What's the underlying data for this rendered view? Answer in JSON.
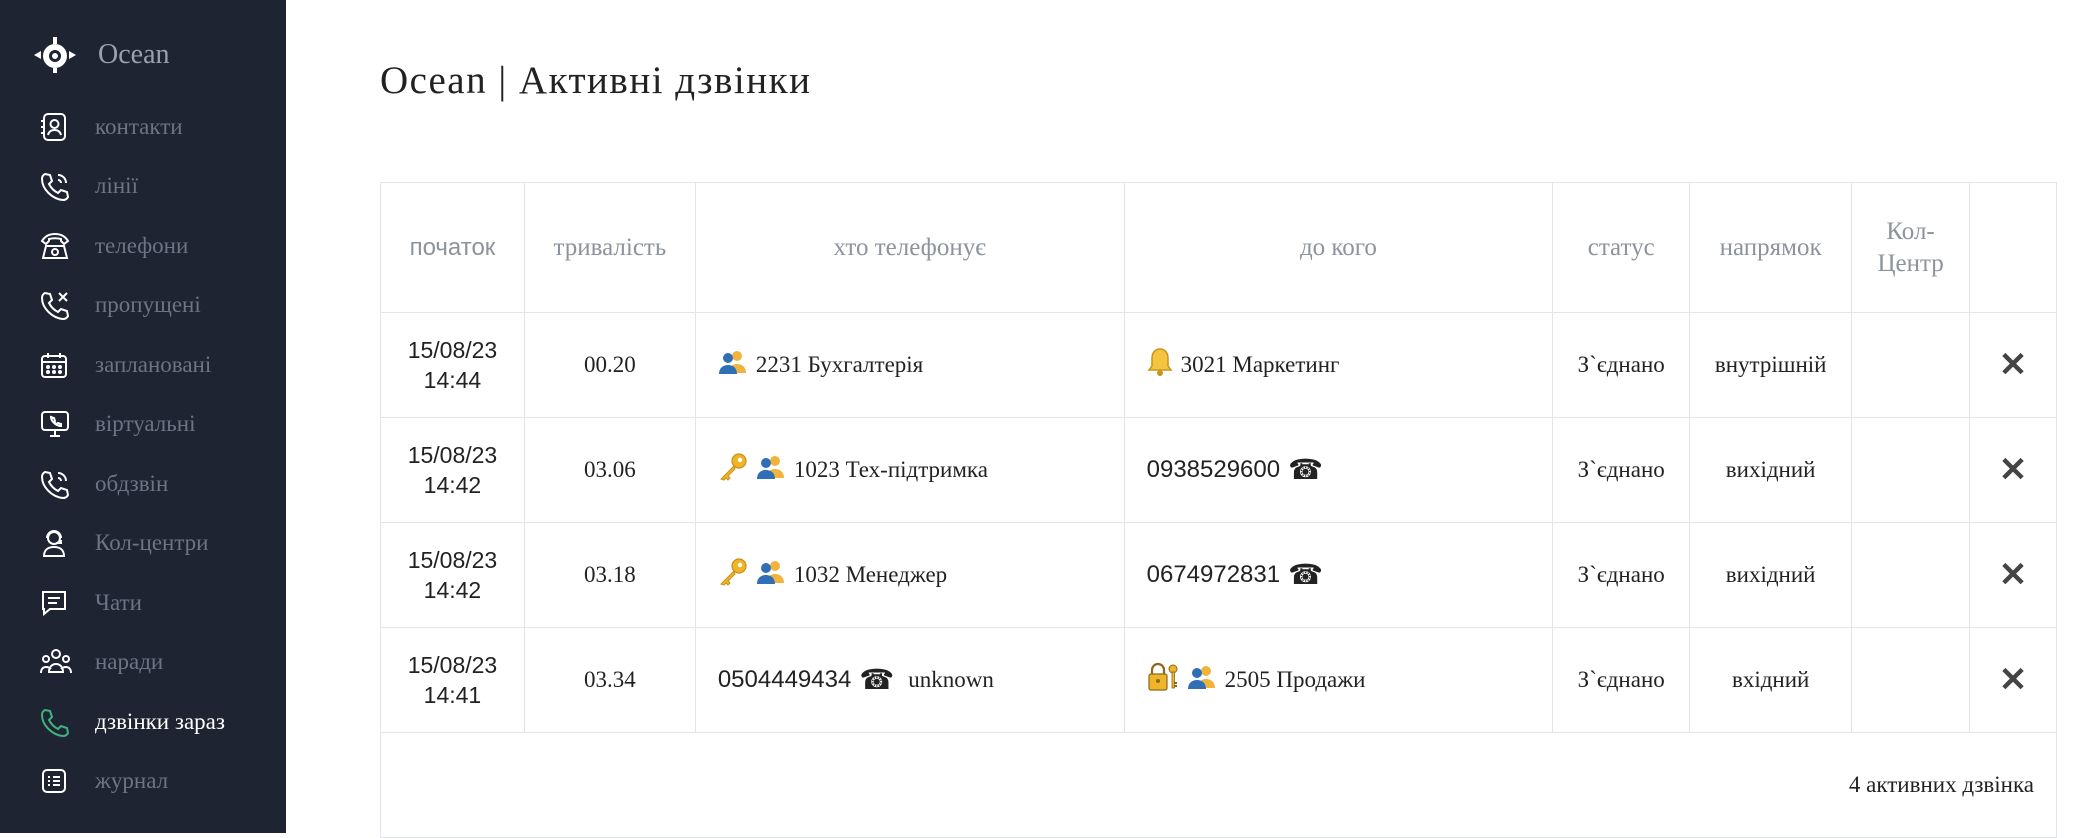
{
  "app": {
    "name": "Ocean"
  },
  "page": {
    "title": "Ocean | Активні дзвінки"
  },
  "nav": [
    {
      "label": "контакти",
      "icon": "contact-book-icon"
    },
    {
      "label": "лінії",
      "icon": "phone-lines-icon"
    },
    {
      "label": "телефони",
      "icon": "desk-phone-icon"
    },
    {
      "label": "пропущені",
      "icon": "missed-call-icon"
    },
    {
      "label": "заплановані",
      "icon": "calendar-icon"
    },
    {
      "label": "віртуальні",
      "icon": "virtual-monitor-icon"
    },
    {
      "label": "обдзвін",
      "icon": "autodial-icon"
    },
    {
      "label": "Кол-центри",
      "icon": "operator-icon"
    },
    {
      "label": "Чати",
      "icon": "chat-icon"
    },
    {
      "label": "наради",
      "icon": "conference-icon"
    },
    {
      "label": "дзвінки зараз",
      "icon": "active-call-icon",
      "active": true
    },
    {
      "label": "журнал",
      "icon": "journal-icon"
    }
  ],
  "table": {
    "headers": {
      "start": "початок",
      "duration": "тривалість",
      "who": "хто телефонує",
      "to": "до кого",
      "status": "статус",
      "direction": "напрямок",
      "callcenter_1": "Кол-",
      "callcenter_2": "Центр"
    },
    "rows": [
      {
        "date": "15/08/23",
        "time": "14:44",
        "duration": "00.20",
        "who": "2231 Бухгалтерія",
        "to": "3021 Маркетинг",
        "status": "З`єднано",
        "direction": "внутрішній",
        "callcenter": ""
      },
      {
        "date": "15/08/23",
        "time": "14:42",
        "duration": "03.06",
        "who": "1023 Тех-підтримка",
        "to": "0938529600",
        "status": "З`єднано",
        "direction": "вихідний",
        "callcenter": ""
      },
      {
        "date": "15/08/23",
        "time": "14:42",
        "duration": "03.18",
        "who": "1032 Менеджер",
        "to": "0674972831",
        "status": "З`єднано",
        "direction": "вихідний",
        "callcenter": ""
      },
      {
        "date": "15/08/23",
        "time": "14:41",
        "duration": "03.34",
        "who": "0504449434",
        "who_name": "unknown",
        "to": "2505 Продажи",
        "status": "З`єднано",
        "direction": "вхідний",
        "callcenter": ""
      }
    ],
    "footer": "4 активних дзвінка"
  },
  "icons": {
    "phone_glyph": "☎",
    "close_glyph": "✕"
  },
  "colors": {
    "sidebar_bg": "#1f2433",
    "active_icon": "#3fb37f",
    "accent_key": "#f0b429"
  }
}
